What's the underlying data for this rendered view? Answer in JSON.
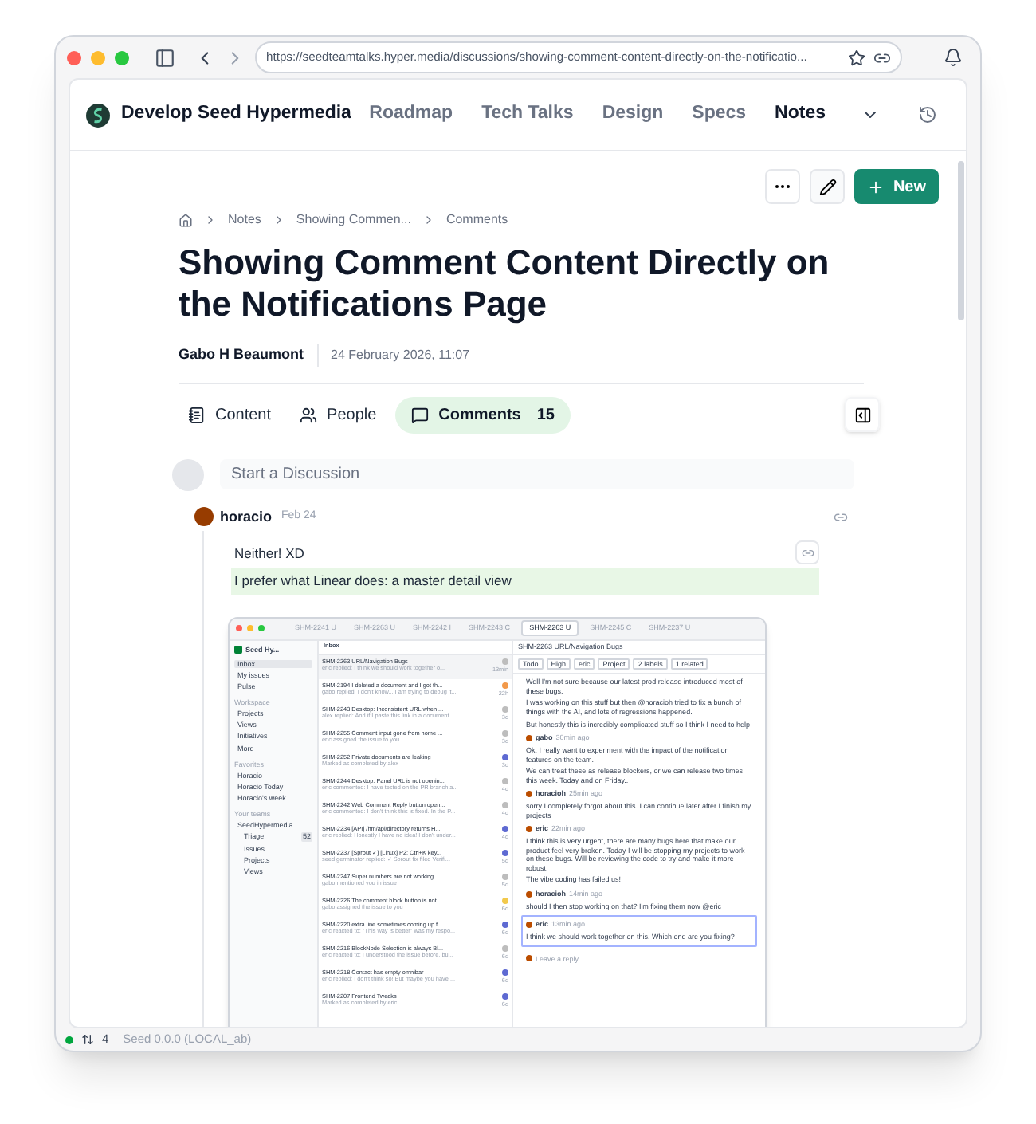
{
  "browser": {
    "url": "https://seedteamtalks.hyper.media/discussions/showing-comment-content-directly-on-the-notificatio..."
  },
  "site": {
    "name": "Develop Seed Hypermedia",
    "nav": [
      {
        "label": "Roadmap",
        "selected": false
      },
      {
        "label": "Tech Talks",
        "selected": false
      },
      {
        "label": "Design",
        "selected": false
      },
      {
        "label": "Specs",
        "selected": false
      },
      {
        "label": "Notes",
        "selected": true
      }
    ]
  },
  "actions": {
    "new_label": "New"
  },
  "breadcrumb": [
    "Notes",
    "Showing Commen...",
    "Comments"
  ],
  "title": "Showing Comment Content Directly on the Notifications Page",
  "author": "Gabo H Beaumont",
  "date": "24 February 2026, 11:07",
  "tabs": [
    {
      "kind": "content",
      "label": "Content",
      "selected": false
    },
    {
      "kind": "people",
      "label": "People",
      "selected": false
    },
    {
      "kind": "comments",
      "label": "Comments",
      "count": "15",
      "selected": true
    }
  ],
  "composer": {
    "placeholder": "Start a Discussion"
  },
  "comment": {
    "author": "horacio",
    "date": "Feb 24",
    "lines": [
      {
        "text": "Neither! XD",
        "highlighted": false
      },
      {
        "text": "I prefer what Linear does: a master detail view",
        "highlighted": true
      }
    ],
    "screenshot": {
      "tabs": [
        {
          "label": "SHM-2241 U",
          "selected": false
        },
        {
          "label": "SHM-2263 U",
          "selected": false
        },
        {
          "label": "SHM-2242 I",
          "selected": false
        },
        {
          "label": "SHM-2243 C",
          "selected": false
        },
        {
          "label": "SHM-2263 U",
          "selected": true
        },
        {
          "label": "SHM-2245 C",
          "selected": false
        },
        {
          "label": "SHM-2237 U",
          "selected": false
        }
      ],
      "workspace": "Seed Hy...",
      "sidebar": [
        {
          "label": "Inbox",
          "selected": true
        },
        {
          "label": "My issues",
          "selected": false
        },
        {
          "label": "Pulse",
          "selected": false
        }
      ],
      "sections": [
        {
          "title": "Workspace",
          "items": [
            {
              "label": "Projects"
            },
            {
              "label": "Views"
            },
            {
              "label": "Initiatives"
            },
            {
              "label": "More"
            }
          ]
        },
        {
          "title": "Favorites",
          "items": [
            {
              "label": "Horacio"
            },
            {
              "label": "Horacio Today"
            },
            {
              "label": "Horacio's week"
            }
          ]
        },
        {
          "title": "Your teams",
          "items": [
            {
              "label": "SeedHypermedia",
              "children": [
                {
                  "label": "Triage",
                  "badge": "52"
                },
                {
                  "label": "Issues"
                },
                {
                  "label": "Projects"
                },
                {
                  "label": "Views"
                }
              ]
            }
          ]
        }
      ],
      "inbox_title": "Inbox",
      "inbox": [
        {
          "title": "SHM-2263 URL/Navigation Bugs",
          "subtitle": "eric replied: I think we should work together o...",
          "time": "13min",
          "color": "#bdbdbd",
          "selected": true
        },
        {
          "title": "SHM-2194 I deleted a document and I got th...",
          "subtitle": "gabo replied: I don't know... I am trying to debug it...",
          "time": "22h",
          "color": "#f2994a",
          "selected": false
        },
        {
          "title": "SHM-2243 Desktop: Inconsistent URL when ...",
          "subtitle": "alex replied: And if I paste this link in a document ...",
          "time": "3d",
          "color": "#bdbdbd",
          "selected": false
        },
        {
          "title": "SHM-2255 Comment input gone from home ...",
          "subtitle": "eric assigned the issue to you",
          "time": "3d",
          "color": "#bdbdbd",
          "selected": false
        },
        {
          "title": "SHM-2252 Private documents are leaking",
          "subtitle": "Marked as completed by alex",
          "time": "3d",
          "color": "#5e6ad2",
          "selected": false
        },
        {
          "title": "SHM-2244 Desktop: Panel URL is not openin...",
          "subtitle": "eric commented: I have tested on the PR branch a...",
          "time": "4d",
          "color": "#bdbdbd",
          "selected": false
        },
        {
          "title": "SHM-2242 Web Comment Reply button open...",
          "subtitle": "eric commented: I don't think this is fixed. In the P...",
          "time": "4d",
          "color": "#bdbdbd",
          "selected": false
        },
        {
          "title": "SHM-2234 [API] /hm/api/directory returns H...",
          "subtitle": "eric replied: Honestly I have no idea! I don't under...",
          "time": "4d",
          "color": "#5e6ad2",
          "selected": false
        },
        {
          "title": "SHM-2237 [Sprout ✓] [Linux] P2: Ctrl+K key...",
          "subtitle": "seed germinator replied: ✓ Sprout fix filed Verifi...",
          "time": "5d",
          "color": "#5e6ad2",
          "selected": false
        },
        {
          "title": "SHM-2247 Super numbers are not working",
          "subtitle": "gabo mentioned you in issue",
          "time": "5d",
          "color": "#bdbdbd",
          "selected": false
        },
        {
          "title": "SHM-2226 The comment block button is not ...",
          "subtitle": "gabo assigned the issue to you",
          "time": "6d",
          "color": "#f2c94c",
          "selected": false
        },
        {
          "title": "SHM-2220 extra line sometimes coming up f...",
          "subtitle": "eric reacted to: \"This way is better\" was my respo...",
          "time": "6d",
          "color": "#5e6ad2",
          "selected": false
        },
        {
          "title": "SHM-2216 BlockNode Selection is always Bl...",
          "subtitle": "eric reacted to: I understood the issue before, bu...",
          "time": "6d",
          "color": "#bdbdbd",
          "selected": false
        },
        {
          "title": "SHM-2218 Contact has empty omnibar",
          "subtitle": "eric replied: I don't think so! But maybe you have ...",
          "time": "6d",
          "color": "#5e6ad2",
          "selected": false
        },
        {
          "title": "SHM-2207 Frontend Tweaks",
          "subtitle": "Marked as completed by eric",
          "time": "6d",
          "color": "#5e6ad2",
          "selected": false
        }
      ],
      "issue_title": "SHM-2263 URL/Navigation Bugs",
      "chips": [
        "Todo",
        "High",
        "eric",
        "Project",
        "2 labels",
        "1 related"
      ],
      "thread": [
        {
          "paragraphs": [
            "Well I'm not sure because our latest prod release introduced most of these bugs.",
            "I was working on this stuff but then @horacioh tried to fix a bunch of things with the AI, and lots of regressions happened.",
            "But honestly this is incredibly complicated stuff so I think I need to help"
          ],
          "selected": false
        },
        {
          "author": "gabo",
          "time": "30min ago",
          "paragraphs": [
            "Ok, I really want to experiment with the impact of the notification features on the team.",
            "We can treat these as release blockers, or we can release two times this week. Today and on Friday.."
          ],
          "selected": false
        },
        {
          "author": "horacioh",
          "time": "25min ago",
          "paragraphs": [
            "sorry I completely forgot about this. I can continue later after I finish my projects"
          ],
          "selected": false
        },
        {
          "author": "eric",
          "time": "22min ago",
          "paragraphs": [
            "I think this is very urgent, there are many bugs here that make our product feel very broken. Today I will be stopping my projects to work on these bugs. Will be reviewing the code to try and make it more robust.",
            "The vibe coding has failed us!"
          ],
          "selected": false
        },
        {
          "author": "horacioh",
          "time": "14min ago",
          "paragraphs": [
            "should I then stop working on that? I'm fixing them now @eric"
          ],
          "selected": false
        },
        {
          "author": "eric",
          "time": "13min ago",
          "paragraphs": [
            "I think we should work together on this. Which one are you fixing?"
          ],
          "selected": true
        }
      ],
      "reply_placeholder": "Leave a reply..."
    }
  },
  "status_bar": {
    "count": "4",
    "version": "Seed 0.0.0 (LOCAL_ab)"
  }
}
